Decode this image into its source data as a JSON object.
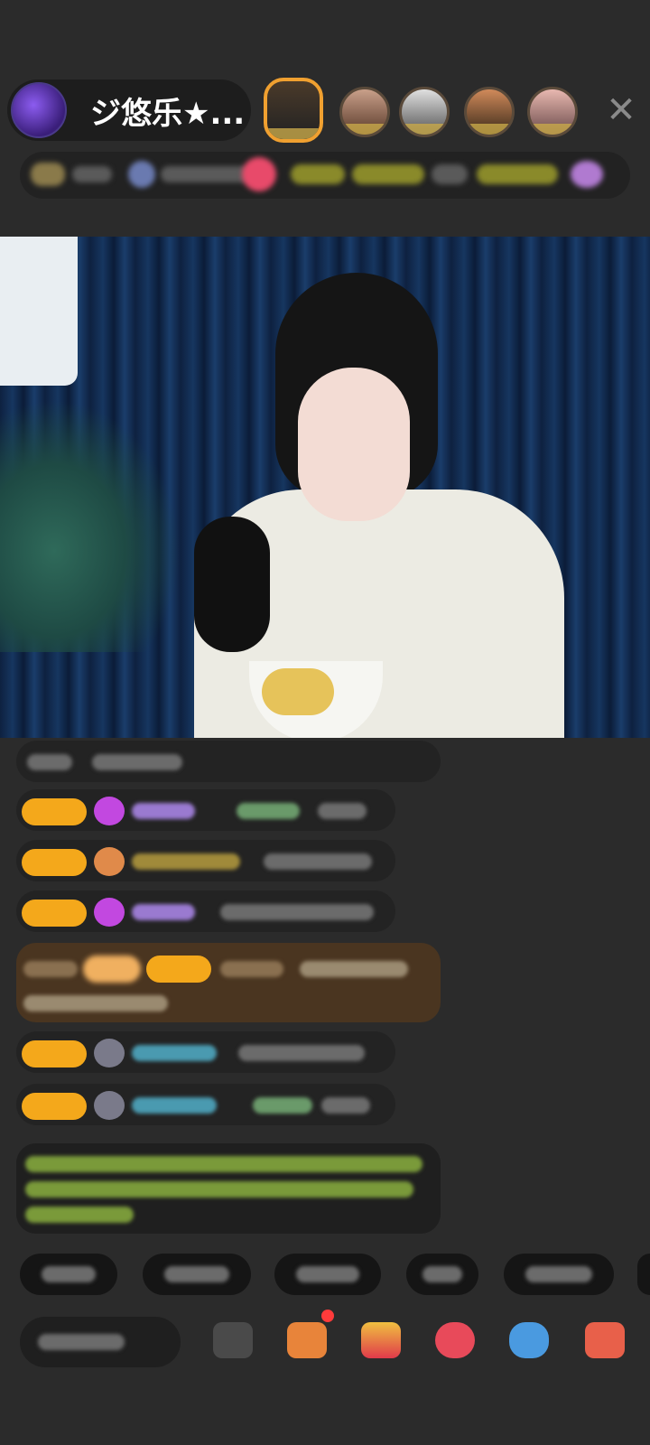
{
  "host": {
    "name": "ジ悠乐★..."
  },
  "header": {
    "close_glyph": "✕"
  },
  "colors": {
    "background": "#2b2b2b",
    "level_badge": "#f4a81b",
    "gift_highlight": "#4a3520"
  },
  "icons": [
    "close-icon",
    "emoji-icon",
    "gift-box-icon",
    "red-packet-icon",
    "heart-icon",
    "game-icon",
    "more-grid-icon"
  ]
}
